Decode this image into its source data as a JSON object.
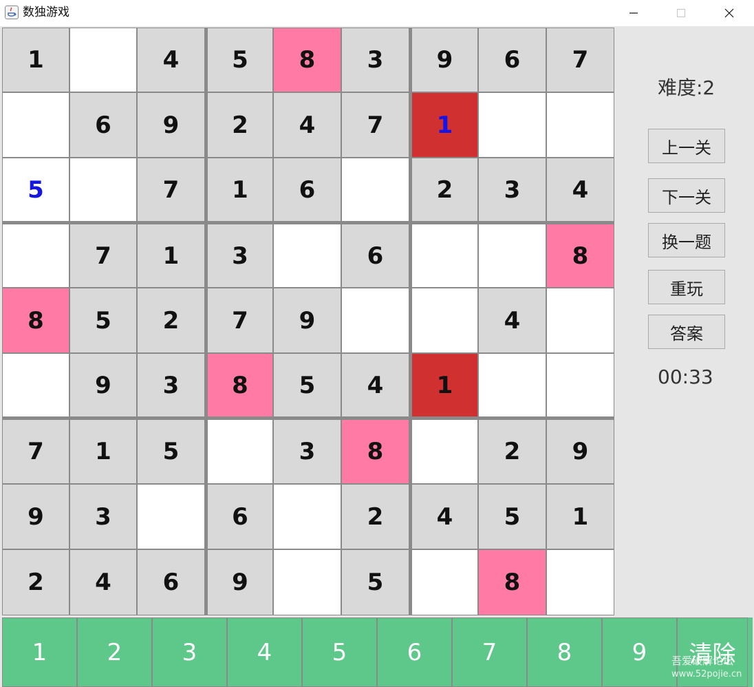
{
  "window": {
    "title": "数独游戏"
  },
  "board": [
    [
      {
        "v": "1",
        "s": "gray"
      },
      {
        "v": "",
        "s": "white"
      },
      {
        "v": "4",
        "s": "gray"
      },
      {
        "v": "5",
        "s": "gray"
      },
      {
        "v": "8",
        "s": "pink"
      },
      {
        "v": "3",
        "s": "gray"
      },
      {
        "v": "9",
        "s": "gray"
      },
      {
        "v": "6",
        "s": "gray"
      },
      {
        "v": "7",
        "s": "gray"
      }
    ],
    [
      {
        "v": "",
        "s": "white"
      },
      {
        "v": "6",
        "s": "gray"
      },
      {
        "v": "9",
        "s": "gray"
      },
      {
        "v": "2",
        "s": "gray"
      },
      {
        "v": "4",
        "s": "gray"
      },
      {
        "v": "7",
        "s": "gray"
      },
      {
        "v": "1",
        "s": "red",
        "blue": true
      },
      {
        "v": "",
        "s": "white"
      },
      {
        "v": "",
        "s": "white"
      }
    ],
    [
      {
        "v": "5",
        "s": "white",
        "blue": true
      },
      {
        "v": "",
        "s": "white"
      },
      {
        "v": "7",
        "s": "gray"
      },
      {
        "v": "1",
        "s": "gray"
      },
      {
        "v": "6",
        "s": "gray"
      },
      {
        "v": "",
        "s": "white"
      },
      {
        "v": "2",
        "s": "gray"
      },
      {
        "v": "3",
        "s": "gray"
      },
      {
        "v": "4",
        "s": "gray"
      }
    ],
    [
      {
        "v": "",
        "s": "white"
      },
      {
        "v": "7",
        "s": "gray"
      },
      {
        "v": "1",
        "s": "gray"
      },
      {
        "v": "3",
        "s": "gray"
      },
      {
        "v": "",
        "s": "white"
      },
      {
        "v": "6",
        "s": "gray"
      },
      {
        "v": "",
        "s": "white"
      },
      {
        "v": "",
        "s": "white"
      },
      {
        "v": "8",
        "s": "pink"
      }
    ],
    [
      {
        "v": "8",
        "s": "pink"
      },
      {
        "v": "5",
        "s": "gray"
      },
      {
        "v": "2",
        "s": "gray"
      },
      {
        "v": "7",
        "s": "gray"
      },
      {
        "v": "9",
        "s": "gray"
      },
      {
        "v": "",
        "s": "white"
      },
      {
        "v": "",
        "s": "white"
      },
      {
        "v": "4",
        "s": "gray"
      },
      {
        "v": "",
        "s": "white"
      }
    ],
    [
      {
        "v": "",
        "s": "white"
      },
      {
        "v": "9",
        "s": "gray"
      },
      {
        "v": "3",
        "s": "gray"
      },
      {
        "v": "8",
        "s": "pink"
      },
      {
        "v": "5",
        "s": "gray"
      },
      {
        "v": "4",
        "s": "gray"
      },
      {
        "v": "1",
        "s": "red"
      },
      {
        "v": "",
        "s": "white"
      },
      {
        "v": "",
        "s": "white"
      }
    ],
    [
      {
        "v": "7",
        "s": "gray"
      },
      {
        "v": "1",
        "s": "gray"
      },
      {
        "v": "5",
        "s": "gray"
      },
      {
        "v": "",
        "s": "white"
      },
      {
        "v": "3",
        "s": "gray"
      },
      {
        "v": "8",
        "s": "pink"
      },
      {
        "v": "",
        "s": "white"
      },
      {
        "v": "2",
        "s": "gray"
      },
      {
        "v": "9",
        "s": "gray"
      }
    ],
    [
      {
        "v": "9",
        "s": "gray"
      },
      {
        "v": "3",
        "s": "gray"
      },
      {
        "v": "",
        "s": "white"
      },
      {
        "v": "6",
        "s": "gray"
      },
      {
        "v": "",
        "s": "white"
      },
      {
        "v": "2",
        "s": "gray"
      },
      {
        "v": "4",
        "s": "gray"
      },
      {
        "v": "5",
        "s": "gray"
      },
      {
        "v": "1",
        "s": "gray"
      }
    ],
    [
      {
        "v": "2",
        "s": "gray"
      },
      {
        "v": "4",
        "s": "gray"
      },
      {
        "v": "6",
        "s": "gray"
      },
      {
        "v": "9",
        "s": "gray"
      },
      {
        "v": "",
        "s": "white"
      },
      {
        "v": "5",
        "s": "gray"
      },
      {
        "v": "",
        "s": "white"
      },
      {
        "v": "8",
        "s": "pink"
      },
      {
        "v": "",
        "s": "white"
      }
    ]
  ],
  "side": {
    "difficulty": "难度:2",
    "prev_level": "上一关",
    "next_level": "下一关",
    "new_puzzle": "换一题",
    "replay": "重玩",
    "answer": "答案",
    "timer": "00:33"
  },
  "numpad": [
    "1",
    "2",
    "3",
    "4",
    "5",
    "6",
    "7",
    "8",
    "9",
    "清除"
  ],
  "watermark": {
    "line1": "吾爱破解论坛",
    "line2": "www.52pojie.cn"
  },
  "colors": {
    "given_cell": "#d9d9d9",
    "empty_cell": "#ffffff",
    "highlight": "#ff7aa5",
    "conflict": "#d03030",
    "numpad": "#5ec78a",
    "user_digit": "#1515e8"
  }
}
